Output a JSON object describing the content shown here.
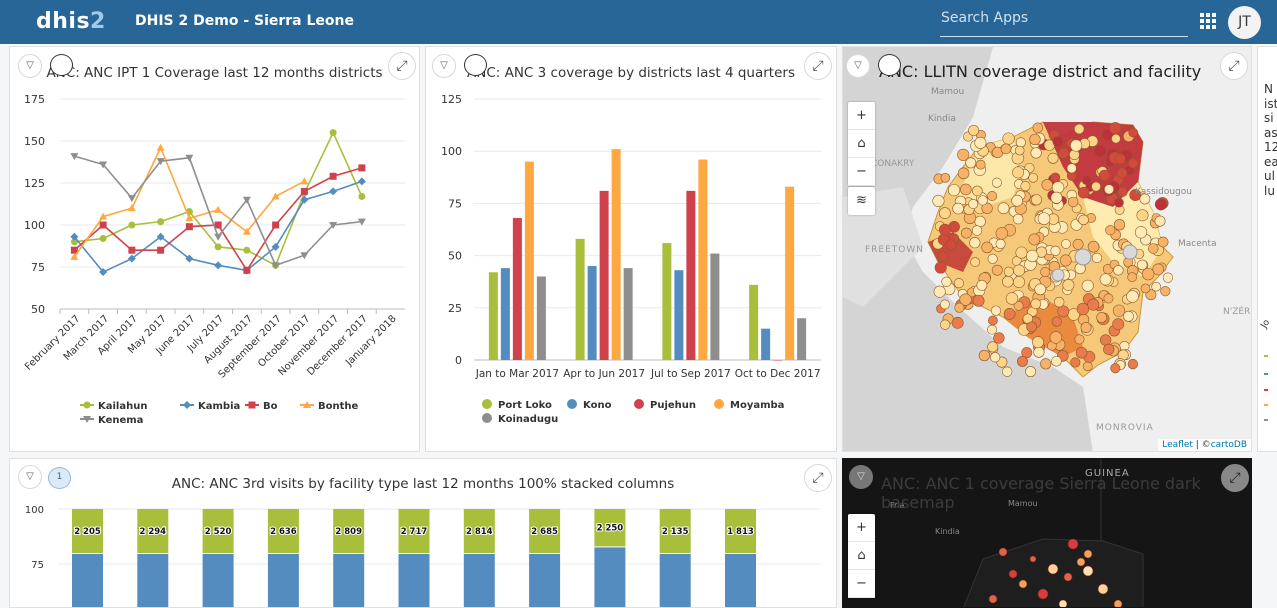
{
  "header": {
    "logo_main": "dhis",
    "logo_num": "2",
    "title": "DHIS 2 Demo - Sierra Leone",
    "search_placeholder": "Search Apps",
    "user_initials": "JT"
  },
  "dashboard_items": {
    "ipt": {
      "title": "ANC: ANC IPT 1 Coverage last 12 months districts"
    },
    "anc3": {
      "title": "ANC: ANC 3 coverage by districts last 4 quarters"
    },
    "map1": {
      "title": "ANC: LLITN coverage district and facility",
      "labels": [
        "Mamou",
        "Kindia",
        "Kassidougou",
        "CONAKRY",
        "FREETOWN",
        "Macenta",
        "N'ZÉR",
        "MONROVIA"
      ],
      "attr_leaflet": "Leaflet",
      "attr_sep": " | ©",
      "attr_carto": "cartoDB"
    },
    "stacked": {
      "title": "ANC: ANC 3rd visits by facility type last 12 months 100% stacked columns",
      "comments": "1"
    },
    "map2": {
      "title": "ANC: ANC 1 coverage Sierra Leone dark basemap",
      "labels": [
        "GUINEA",
        "Fria",
        "Kindia",
        "Mamou"
      ]
    }
  },
  "side_partial": {
    "lines": [
      "N",
      "ist",
      "si",
      "as",
      "12",
      "ea",
      "ul",
      "lu"
    ],
    "axis": "Jo"
  },
  "map_controls": {
    "zoom_in": "+",
    "zoom_out": "−"
  },
  "colors": {
    "header": "#276696",
    "kailahun": "#a9be3b",
    "kambia": "#558cc0",
    "bo": "#d0424b",
    "bonthe": "#ffa740",
    "kenema": "#8e8e8e"
  },
  "charts": [
    {
      "type": "line",
      "ylim": [
        50,
        175
      ],
      "yticks": [
        "175",
        "150",
        "125",
        "100",
        "75",
        "50"
      ],
      "categories": [
        "February 2017",
        "March 2017",
        "April 2017",
        "May 2017",
        "June 2017",
        "July 2017",
        "August 2017",
        "September 2017",
        "October 2017",
        "November 2017",
        "December 2017",
        "January 2018"
      ],
      "series": [
        {
          "name": "Kailahun",
          "values": [
            90,
            92,
            100,
            102,
            108,
            87,
            85,
            76,
            119,
            155,
            117,
            null
          ]
        },
        {
          "name": "Kambia",
          "values": [
            93,
            72,
            80,
            93,
            80,
            76,
            73,
            87,
            115,
            120,
            126,
            null
          ]
        },
        {
          "name": "Bo",
          "values": [
            85,
            100,
            85,
            85,
            99,
            100,
            73,
            100,
            120,
            129,
            134,
            null
          ]
        },
        {
          "name": "Bonthe",
          "values": [
            81,
            105,
            110,
            146,
            104,
            109,
            96,
            117,
            126,
            null,
            null,
            null
          ]
        },
        {
          "name": "Kenema",
          "values": [
            141,
            136,
            116,
            138,
            140,
            93,
            115,
            76,
            82,
            100,
            102,
            null
          ]
        }
      ]
    },
    {
      "type": "bar",
      "ylim": [
        0,
        125
      ],
      "yticks": [
        "125",
        "100",
        "75",
        "50",
        "25",
        "0"
      ],
      "categories": [
        "Jan to Mar 2017",
        "Apr to Jun 2017",
        "Jul to Sep 2017",
        "Oct to Dec 2017"
      ],
      "series": [
        {
          "name": "Port Loko",
          "values": [
            42,
            58,
            56,
            36
          ]
        },
        {
          "name": "Kono",
          "values": [
            44,
            45,
            43,
            15
          ]
        },
        {
          "name": "Pujehun",
          "values": [
            68,
            81,
            81,
            0
          ]
        },
        {
          "name": "Moyamba",
          "values": [
            95,
            101,
            96,
            83
          ]
        },
        {
          "name": "Koinadugu",
          "values": [
            40,
            44,
            51,
            20
          ]
        }
      ]
    },
    {
      "type": "bar",
      "ylim": [
        0,
        100
      ],
      "yticks": [
        "100",
        "75"
      ],
      "top_labels": [
        "2 205",
        "2 294",
        "2 520",
        "2 636",
        "2 809",
        "2 717",
        "2 814",
        "2 685",
        "2 250",
        "2 135",
        "1 813"
      ],
      "top_share": [
        20,
        20,
        20,
        20,
        20,
        20,
        20,
        20,
        17,
        20,
        20
      ]
    }
  ]
}
